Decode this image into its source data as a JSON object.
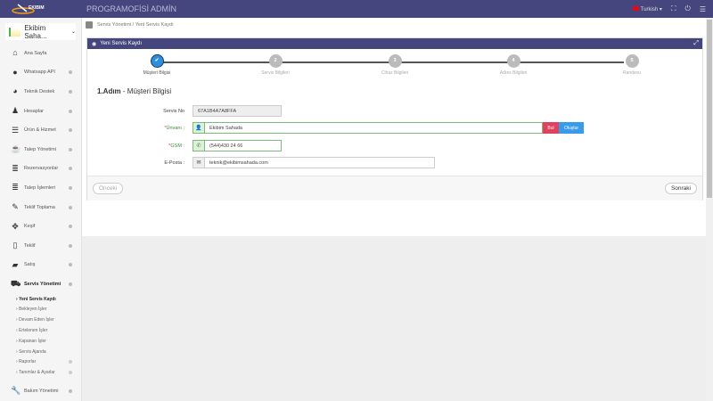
{
  "header": {
    "logo_text": "EKIBIM",
    "app_title": "PROGRAMOFİSİ ADMİN",
    "language": "Turkish"
  },
  "sidebar": {
    "company": "Ekibim Saha...",
    "items": [
      {
        "label": "Ana Sayfa",
        "icon": "home-icon"
      },
      {
        "label": "Whatsapp API",
        "icon": "chat-icon"
      },
      {
        "label": "Teknik Destek",
        "icon": "support-icon"
      },
      {
        "label": "Hesaplar",
        "icon": "user-icon"
      },
      {
        "label": "Ürün & Hizmet",
        "icon": "database-icon"
      },
      {
        "label": "Talep Yönetimi",
        "icon": "coffee-icon"
      },
      {
        "label": "Rezervasyonlar",
        "icon": "list-icon"
      },
      {
        "label": "Talep İşlemleri",
        "icon": "list-icon"
      },
      {
        "label": "Teklif Toplama",
        "icon": "edit-icon"
      },
      {
        "label": "Keşif",
        "icon": "move-icon"
      },
      {
        "label": "Teklif",
        "icon": "file-icon"
      },
      {
        "label": "Satış",
        "icon": "briefcase-icon"
      },
      {
        "label": "Servis Yönetimi",
        "icon": "truck-icon"
      }
    ],
    "sub_items": [
      "Yeni Servis Kaydı",
      "Bekleyen İşler",
      "Devam Eden İşler",
      "Ertelenen İşler",
      "Kapanan İşler",
      "Servis Ajanda",
      "Raporlar",
      "Tanımlar & Ayarlar"
    ],
    "last_item": "Bakım Yönetimi"
  },
  "breadcrumb": [
    "Servis Yönetimi",
    "Yeni Servis Kaydı"
  ],
  "card": {
    "title": "Yeni Servis Kaydı",
    "steps": [
      {
        "num": "✔",
        "label": "Müşteri Bilgisi"
      },
      {
        "num": "2",
        "label": "Servis Bilgileri"
      },
      {
        "num": "3",
        "label": "Cihaz Bilgileri"
      },
      {
        "num": "4",
        "label": "Adres Bilgileri"
      },
      {
        "num": "5",
        "label": "Randevu"
      }
    ],
    "heading_bold": "1.Adım",
    "heading_rest": " - Müşteri Bilgisi",
    "form": {
      "servis_no_label": "Servis No",
      "servis_no": "67A1B4A7A8FFA",
      "unvan_label": "Ünvanı :",
      "unvan": "Ekibim Sahada",
      "bul": "Bul",
      "olustur": "Oluştur",
      "gsm_label": "GSM :",
      "gsm": "(544)430 24 66",
      "email_label": "E-Posta :",
      "email": "teknik@ekibimsahada.com",
      "required_mark": "*"
    },
    "prev": "Önceki",
    "next": "Sonraki"
  }
}
